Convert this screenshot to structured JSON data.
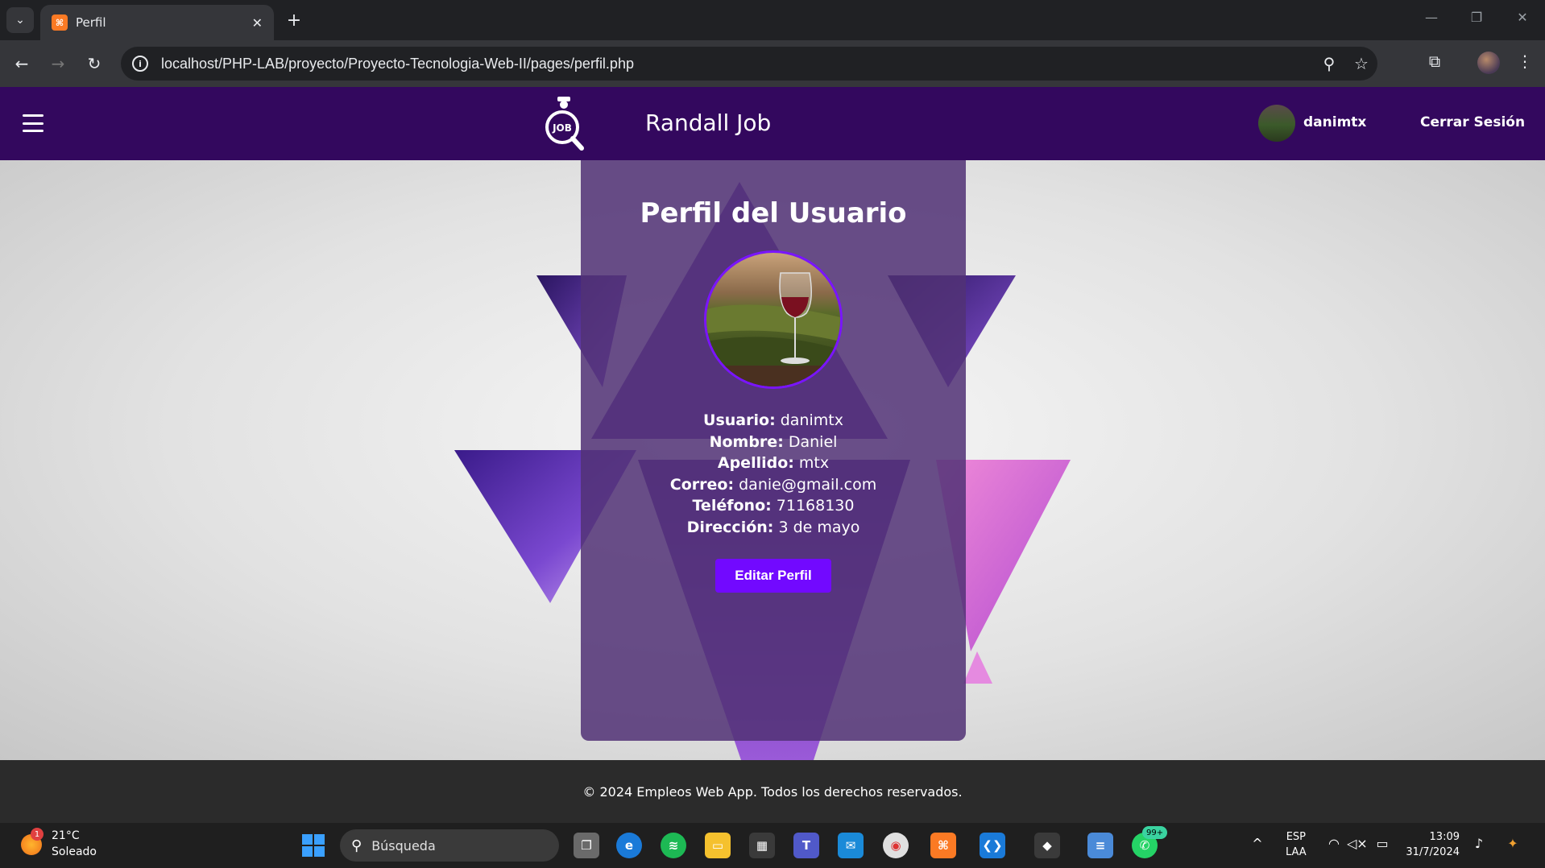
{
  "browser": {
    "tab_title": "Perfil",
    "url": "localhost/PHP-LAB/proyecto/Proyecto-Tecnologia-Web-II/pages/perfil.php"
  },
  "header": {
    "site_title": "Randall Job",
    "logo_text": "JOB",
    "username": "danimtx",
    "logout_label": "Cerrar Sesión"
  },
  "profile": {
    "title": "Perfil del Usuario",
    "fields": [
      {
        "label": "Usuario:",
        "value": "danimtx"
      },
      {
        "label": "Nombre:",
        "value": "Daniel"
      },
      {
        "label": "Apellido:",
        "value": "mtx"
      },
      {
        "label": "Correo:",
        "value": "danie@gmail.com"
      },
      {
        "label": "Teléfono:",
        "value": "71168130"
      },
      {
        "label": "Dirección:",
        "value": "3 de mayo"
      }
    ],
    "edit_button": "Editar Perfil"
  },
  "footer": {
    "text": "© 2024 Empleos Web App. Todos los derechos reservados."
  },
  "taskbar": {
    "weather_temp": "21°C",
    "weather_desc": "Soleado",
    "weather_badge": "1",
    "search_label": "Búsqueda",
    "whatsapp_badge": "99+",
    "lang_top": "ESP",
    "lang_bottom": "LAA",
    "time": "13:09",
    "date": "31/7/2024"
  },
  "colors": {
    "header_bg": "#33085e",
    "card_bg": "#523276",
    "button_bg": "#7209ff",
    "footer_bg": "#2b2b2b"
  }
}
